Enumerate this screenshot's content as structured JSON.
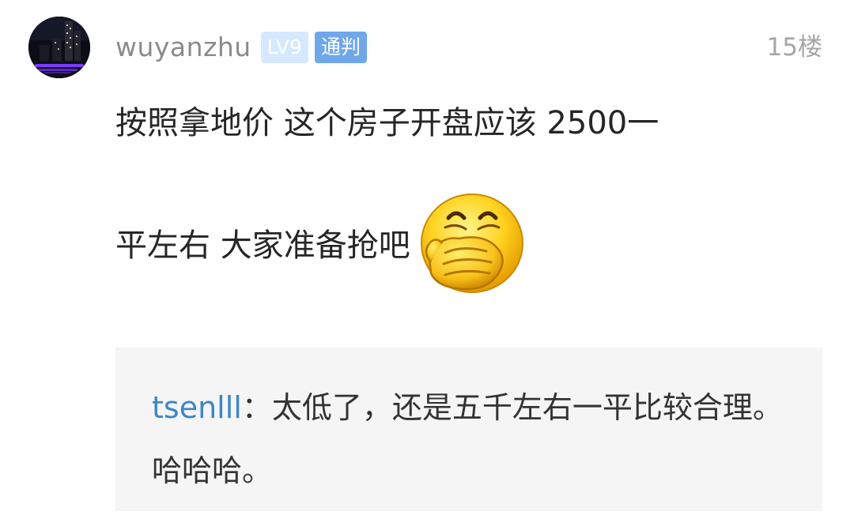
{
  "post": {
    "username": "wuyanzhu",
    "level_badge": "LV9",
    "title_badge": "通判",
    "floor": "15楼",
    "content_line1": "按照拿地价 这个房子开盘应该 2500一",
    "content_line2": "平左右 大家准备抢吧",
    "emoji": "covering-mouth-laugh-emoji"
  },
  "reply": {
    "author": "tsenlll",
    "separator": "：",
    "text": "太低了，还是五千左右一平比较合理。哈哈哈。"
  },
  "colors": {
    "username": "#8b8b8b",
    "level_badge_bg": "#d6e8ff",
    "title_badge_bg": "#6ea7ea",
    "reply_author": "#3d86c6",
    "quote_bg": "#f5f5f5"
  }
}
